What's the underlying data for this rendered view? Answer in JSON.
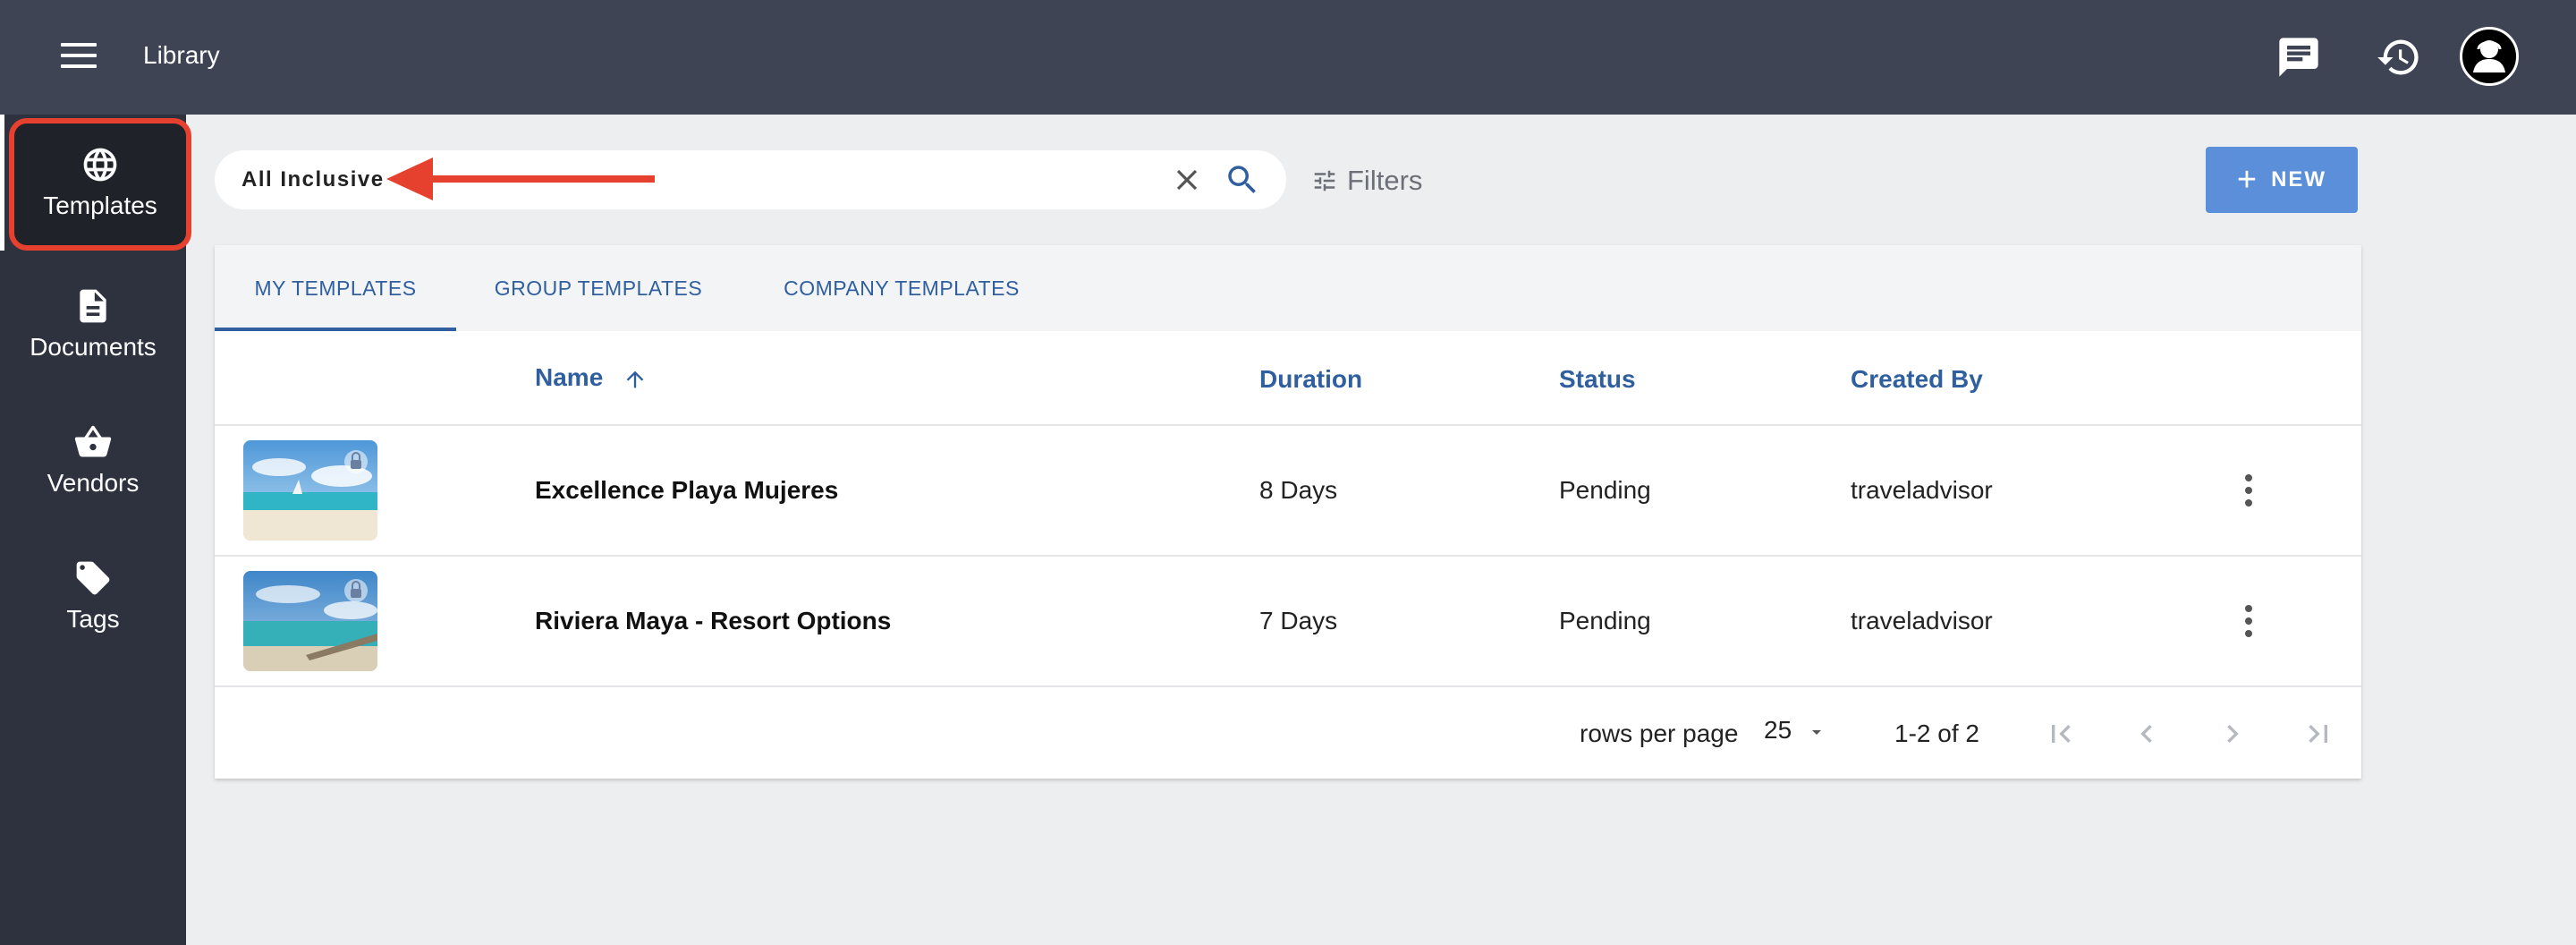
{
  "header": {
    "title": "Library",
    "icons": [
      "menu-icon",
      "chat-icon",
      "history-icon",
      "avatar"
    ]
  },
  "sidebar": {
    "items": [
      {
        "label": "Templates",
        "icon": "globe-icon",
        "active": true
      },
      {
        "label": "Documents",
        "icon": "document-icon"
      },
      {
        "label": "Vendors",
        "icon": "basket-icon"
      },
      {
        "label": "Tags",
        "icon": "tag-icon"
      }
    ]
  },
  "search": {
    "value": "All Inclusive",
    "placeholder": ""
  },
  "filters_label": "Filters",
  "new_button": {
    "label": "NEW"
  },
  "tabs": [
    {
      "label": "MY TEMPLATES",
      "active": true
    },
    {
      "label": "GROUP TEMPLATES"
    },
    {
      "label": "COMPANY TEMPLATES"
    }
  ],
  "table": {
    "columns": [
      "Name",
      "Duration",
      "Status",
      "Created By"
    ],
    "sort": {
      "column": "Name",
      "direction": "ascending"
    },
    "rows": [
      {
        "name": "Excellence Playa Mujeres",
        "duration": "8 Days",
        "status": "Pending",
        "created_by": "traveladvisor",
        "locked": true
      },
      {
        "name": "Riviera Maya - Resort Options",
        "duration": "7 Days",
        "status": "Pending",
        "created_by": "traveladvisor",
        "locked": true
      }
    ]
  },
  "pagination": {
    "rows_per_page_label": "rows per page",
    "rows_per_page": "25",
    "range": "1-2 of 2"
  },
  "colors": {
    "topbar": "#3f4454",
    "sidebar": "#2e323f",
    "accent": "#2f5f9f",
    "new_button": "#5b8fd9",
    "annotation": "#e6402e"
  }
}
